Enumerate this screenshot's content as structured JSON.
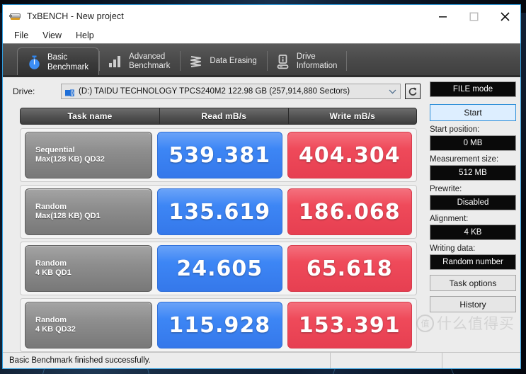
{
  "window": {
    "title": "TxBENCH - New project",
    "app_icon": "drive-icon",
    "controls": {
      "minimize": "minimize-icon",
      "maximize": "maximize-icon",
      "close": "close-icon"
    }
  },
  "menu": {
    "items": [
      {
        "label": "File"
      },
      {
        "label": "View"
      },
      {
        "label": "Help"
      }
    ]
  },
  "tabs": [
    {
      "label_line1": "Basic",
      "label_line2": "Benchmark",
      "icon": "stopwatch-icon",
      "active": true
    },
    {
      "label_line1": "Advanced",
      "label_line2": "Benchmark",
      "icon": "bar-chart-icon",
      "active": false
    },
    {
      "label_line1": "Data Erasing",
      "label_line2": "",
      "icon": "shredder-icon",
      "active": false
    },
    {
      "label_line1": "Drive",
      "label_line2": "Information",
      "icon": "drive-info-icon",
      "active": false
    }
  ],
  "drive": {
    "label": "Drive:",
    "selected": "(D:) TAIDU TECHNOLOGY TPCS240M2  122.98 GB (257,914,880 Sectors)",
    "dropdown_icon": "chevron-down-icon",
    "refresh_icon": "refresh-icon"
  },
  "results": {
    "headers": {
      "task": "Task name",
      "read": "Read mB/s",
      "write": "Write mB/s"
    },
    "rows": [
      {
        "task_line1": "Sequential",
        "task_line2": "Max(128 KB) QD32",
        "read": "539.381",
        "write": "404.304"
      },
      {
        "task_line1": "Random",
        "task_line2": "Max(128 KB) QD1",
        "read": "135.619",
        "write": "186.068"
      },
      {
        "task_line1": "Random",
        "task_line2": "4 KB QD1",
        "read": "24.605",
        "write": "65.618"
      },
      {
        "task_line1": "Random",
        "task_line2": "4 KB QD32",
        "read": "115.928",
        "write": "153.391"
      }
    ]
  },
  "sidebar": {
    "mode_value": "FILE mode",
    "start_label": "Start",
    "start_position_label": "Start position:",
    "start_position_value": "0 MB",
    "measurement_size_label": "Measurement size:",
    "measurement_size_value": "512 MB",
    "prewrite_label": "Prewrite:",
    "prewrite_value": "Disabled",
    "alignment_label": "Alignment:",
    "alignment_value": "4 KB",
    "writing_data_label": "Writing data:",
    "writing_data_value": "Random number",
    "task_options_label": "Task options",
    "history_label": "History"
  },
  "statusbar": {
    "message": "Basic Benchmark finished successfully."
  },
  "watermark": {
    "mark": "值",
    "text": "什么值得买"
  },
  "colors": {
    "read_blue": "#3d86f5",
    "write_red": "#ef4a5a",
    "window_border": "#2f9ee0",
    "panel_bg": "#ececec",
    "tab_bg": "#4a4a4a",
    "accent_start": "#2f8fd8"
  }
}
